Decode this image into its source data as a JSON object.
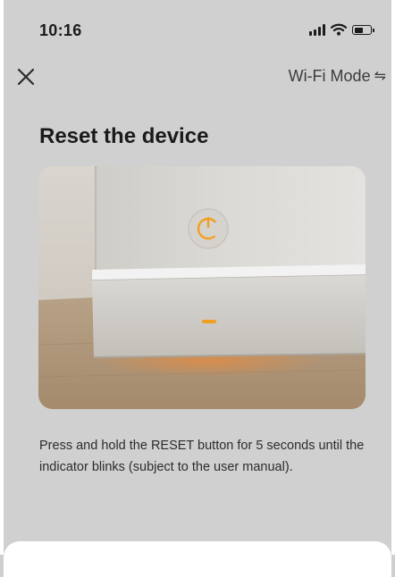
{
  "status_bar": {
    "time": "10:16",
    "icons": [
      "cellular-signal",
      "wifi",
      "battery"
    ]
  },
  "nav": {
    "close_icon": "close",
    "mode_label": "Wi-Fi Mode",
    "mode_icon": "⇋"
  },
  "page": {
    "title": "Reset the device",
    "instruction": "Press and hold the RESET button for 5 seconds until the indicator blinks (subject to the user manual)."
  },
  "image": {
    "subject": "smart-home-device",
    "indicator_color": "#f0a020"
  },
  "colors": {
    "overlay_background": "#d0d0d0",
    "text_primary": "#1a1a1a",
    "accent_orange": "#f0a020"
  }
}
